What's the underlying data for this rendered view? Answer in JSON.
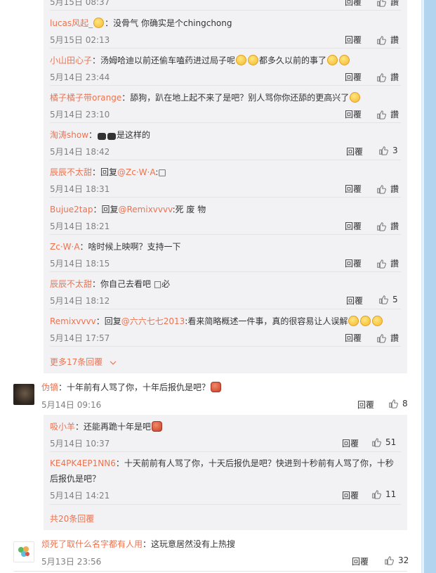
{
  "top_partial": {
    "time": "5月15日 08:37",
    "reply": "回覆"
  },
  "replies_group1": [
    {
      "user": "lucas风起_",
      "text": "：没骨气  你确实是个chingchong",
      "time": "5月15日 02:13",
      "reply": "回覆",
      "likes": "",
      "emojis_before": 1
    },
    {
      "user": "小山田心子",
      "text": "：汤姆哈迪以前还偷车嗑药进过局子呢",
      "text2": "都多久以前的事了",
      "time": "5月14日 23:44",
      "reply": "回覆",
      "likes": ""
    },
    {
      "user": "橘子橘子带orange",
      "text": "：舔狗，趴在地上起不来了是吧？别人骂你你还舔的更高兴了",
      "time": "5月14日 23:10",
      "reply": "回覆",
      "likes": ""
    },
    {
      "user": "淘涛show",
      "text": "是这样的",
      "time": "5月14日 18:42",
      "reply": "回覆",
      "likes": "3"
    },
    {
      "user": "辰辰不太甜",
      "text_prefix": "：回复",
      "mention": "@Zc·W·A",
      "text": ":□",
      "time": "5月14日 18:31",
      "reply": "回覆",
      "likes": ""
    },
    {
      "user": "Bujue2tap",
      "text_prefix": "：回复",
      "mention": "@Remixvvvv",
      "text": ":死  废  物",
      "time": "5月14日 18:21",
      "reply": "回覆",
      "likes": ""
    },
    {
      "user": "Zc·W·A",
      "text": "：啥时候上映啊？支持一下",
      "time": "5月14日 18:15",
      "reply": "回覆",
      "likes": ""
    },
    {
      "user": "辰辰不太甜",
      "text": "：你自己去看吧 □必",
      "time": "5月14日 18:12",
      "reply": "回覆",
      "likes": "5"
    },
    {
      "user": "Remixvvvv",
      "text_prefix": "：回复",
      "mention": "@六六七七2013",
      "text": ":看来简略概述一件事，真的很容易让人误解",
      "time": "5月14日 17:57",
      "reply": "回覆",
      "likes": ""
    }
  ],
  "more1": "更多17条回覆",
  "comment2": {
    "user": "伪镝",
    "text": "：十年前有人骂了你，十年后报仇是吧？",
    "time": "5月14日 09:16",
    "reply": "回覆",
    "likes": "8"
  },
  "replies_group2": [
    {
      "user": "吸小羊",
      "text": "：还能再跪十年是吧",
      "time": "5月14日 10:37",
      "reply": "回覆",
      "likes": "51"
    },
    {
      "user": "KE4PK4EP1NN6",
      "text": "：十天前前有人骂了你，十天后报仇是吧？快进到十秒前有人骂了你，十秒后报仇是吧？",
      "time": "5月14日 14:21",
      "reply": "回覆",
      "likes": "11"
    }
  ],
  "more2": "共20条回覆",
  "comment3": {
    "user": "烦死了取什么名字都有人用",
    "text": "：这玩意居然没有上热搜",
    "time": "5月13日 23:56",
    "reply": "回覆",
    "likes": "32"
  },
  "like_label": "讚",
  "icons": {
    "like": "thumbs-up-icon",
    "chevron": "chevron-down-icon"
  },
  "colors": {
    "link": "#eb7350",
    "reply_bg": "#f2f2f5",
    "scrollbar": "#b3d4ee"
  }
}
